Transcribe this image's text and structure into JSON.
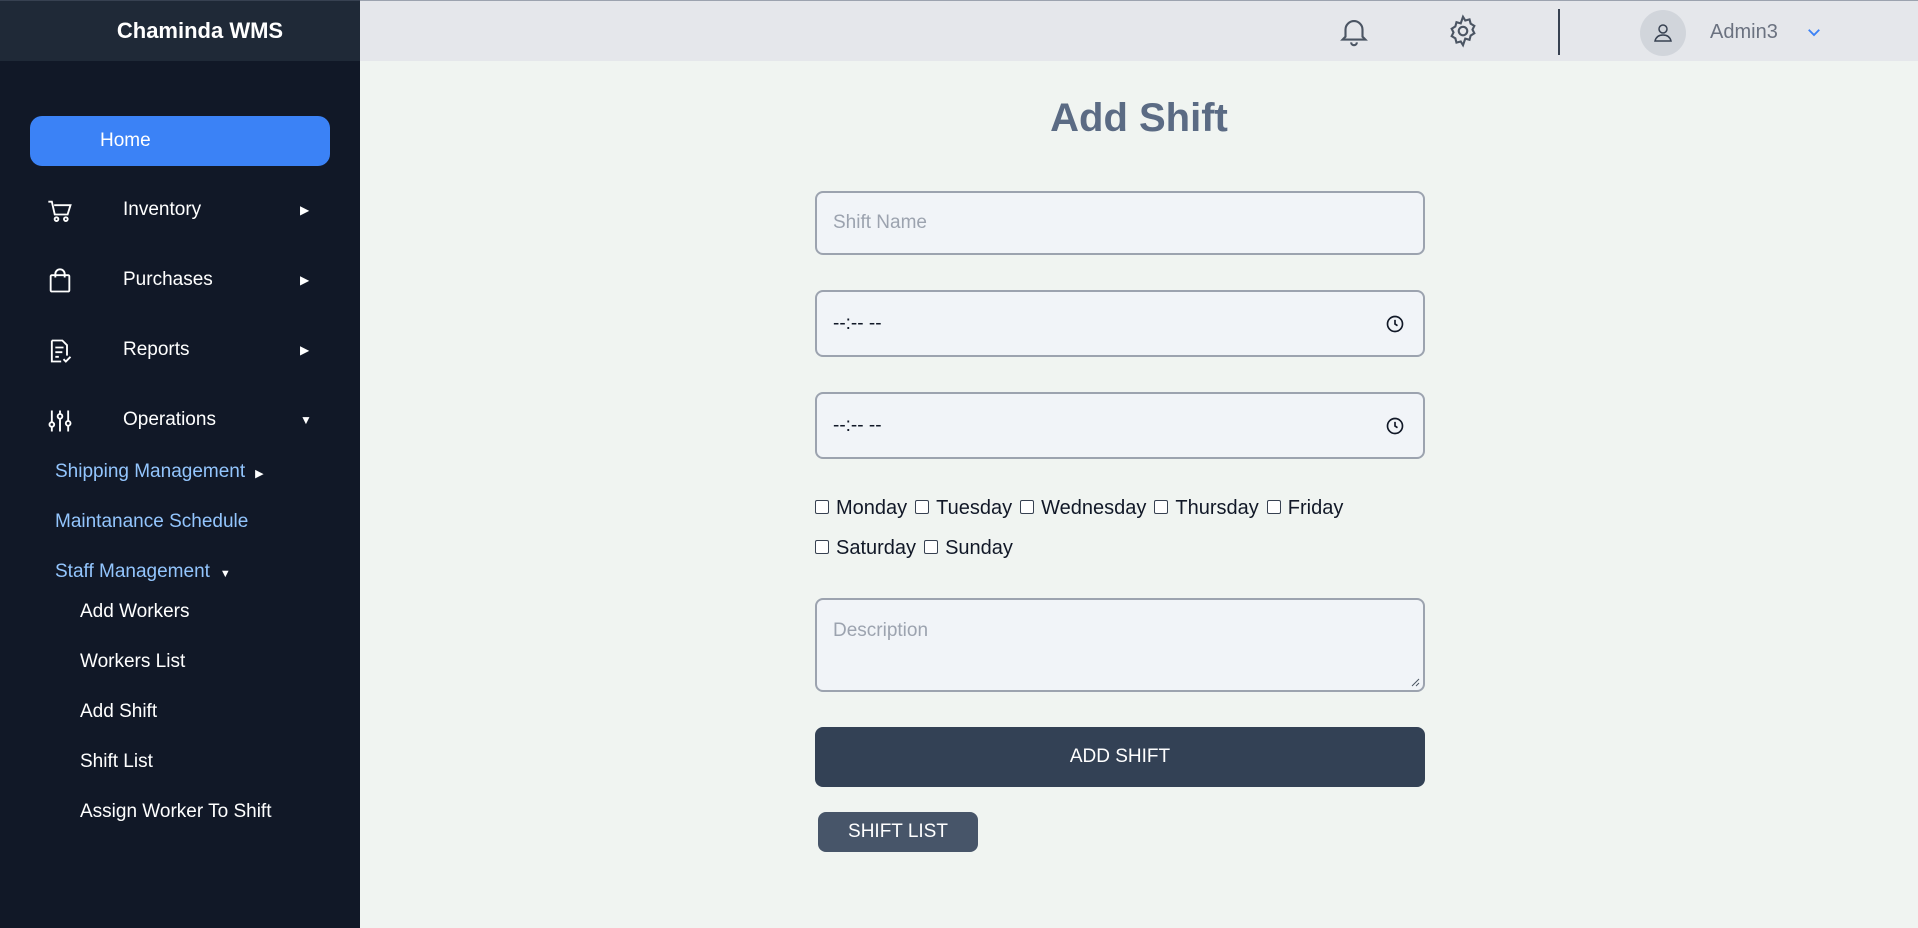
{
  "app": {
    "title": "Chaminda WMS"
  },
  "sidebar": {
    "home": "Home",
    "items": [
      {
        "label": "Inventory",
        "icon": "cart-icon",
        "arrow": "▶"
      },
      {
        "label": "Purchases",
        "icon": "bag-icon",
        "arrow": "▶"
      },
      {
        "label": "Reports",
        "icon": "report-icon",
        "arrow": "▶"
      },
      {
        "label": "Operations",
        "icon": "sliders-icon",
        "arrow": "▼"
      }
    ],
    "operations_sub": [
      {
        "label": "Shipping Management",
        "arrow": "▶"
      },
      {
        "label": "Maintanance Schedule"
      },
      {
        "label": "Staff Management",
        "arrow": "▼"
      }
    ],
    "staff_sub": [
      "Add Workers",
      "Workers List",
      "Add Shift",
      "Shift List",
      "Assign Worker To Shift"
    ]
  },
  "topbar": {
    "user": "Admin3",
    "icons": [
      "bell-icon",
      "gear-icon",
      "user-icon",
      "chevron-down-icon"
    ]
  },
  "form": {
    "title": "Add Shift",
    "shift_name_placeholder": "Shift Name",
    "start_time": "--:-- --",
    "end_time": "--:-- --",
    "days": [
      "Monday",
      "Tuesday",
      "Wednesday",
      "Thursday",
      "Friday",
      "Saturday",
      "Sunday"
    ],
    "description_placeholder": "Description",
    "submit_label": "ADD SHIFT",
    "list_label": "SHIFT LIST"
  },
  "colors": {
    "sidebar": "#111827",
    "accent": "#3b82f6",
    "button": "#334155",
    "link": "#93c5fd"
  }
}
